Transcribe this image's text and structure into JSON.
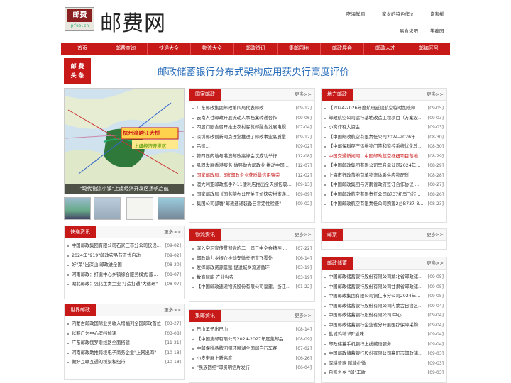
{
  "site": {
    "logo_top": "邮费",
    "logo_bottom": "pfee.cn",
    "name": "邮费网"
  },
  "toplinks": [
    "吃海鲜网",
    "家乡的特色作文",
    "询害缓",
    "易食烤吧",
    "笑癫园"
  ],
  "nav": [
    "首页",
    "邮费查询",
    "快递大全",
    "物流大全",
    "邮政资讯",
    "集邮园地",
    "邮政展会",
    "邮政人才",
    "邮编区号"
  ],
  "badge": {
    "line1": "邮 费",
    "line2": "头 条"
  },
  "headline": "邮政储蓄银行分布式架构应用获央行高度评价",
  "slideshow": {
    "caption": "\"现代物流小镇\"上虞经济开发区扬帆启航",
    "map_title": "杭州湾跨江大桥",
    "map_subtitle": "上虞经济开发区"
  },
  "panels": {
    "guonei": {
      "title": "国家邮政",
      "more": "更多>>",
      "items": [
        {
          "t": "广东邮政集团邮政第四局代表邮政",
          "d": "[09-12]"
        },
        {
          "t": "云南人社邮政开展流动人事档案转递合作",
          "d": "[09-06]"
        },
        {
          "t": "四届门限合召开推进农村客货邮融合发展电视电…",
          "d": "[07-04]"
        },
        {
          "t": "深圳邮政创新网点理念推进了邮政事业高质量发展…",
          "d": "[09-12]"
        },
        {
          "t": "吕建…",
          "d": "[09-02]"
        },
        {
          "t": "第四届内地与港澳邮政高峰会议成功举行",
          "d": "[12-08]"
        },
        {
          "t": "巩固发展香港服务 做强做大邮政业 推动中国邮…",
          "d": "[12-07]"
        },
        {
          "t": "国家邮政局：5家邮政企业获质量信用殊荣",
          "d": "[12-02]",
          "red": true
        },
        {
          "t": "澳大利亚邮政携手7-11便利店推出全天候包裹储…",
          "d": "[09-13]"
        },
        {
          "t": "国家邮政局《国务院办公厅关于加快农村寄递物流…",
          "d": "[09-09]"
        },
        {
          "t": "集团公司部署\"邮递速递装备日常定性检查\"",
          "d": "[09-02]"
        }
      ]
    },
    "difang": {
      "title": "地方邮政",
      "more": "更多>>",
      "items": [
        {
          "t": "【2024-2026年度航班延误航空临时加班邮路业务外包…",
          "d": "[09-05]"
        },
        {
          "t": "邮政航空公司运行基地改造工程项目（方案设计…",
          "d": "[09-03]"
        },
        {
          "t": "小窝作有大资金",
          "d": "[09-03]"
        },
        {
          "t": "【中国邮政航空有限责任公司2024-2026年飞机地…",
          "d": "[08-30]"
        },
        {
          "t": "【中邮保科存庄运维物门禁和监控系统优化改造…",
          "d": "[08-30]"
        },
        {
          "t": "中国交通新闻网：中国邮政航空枢纽项目落地郑州",
          "d": "[08-29]",
          "red": true
        },
        {
          "t": "【中国邮政集团有限公司黑名单公司2024年年…",
          "d": "[08-29]"
        },
        {
          "t": "上海市行政落地首单物流体系供应物配货",
          "d": "[08-28]"
        },
        {
          "t": "【中国邮政集团与河南省政府签订合作协议 中国邮…",
          "d": "[08-27]"
        },
        {
          "t": "【中国邮政航空有限责任公司B737机型飞行员租…",
          "d": "[08-26]"
        },
        {
          "t": "【中国邮政航空有限责任公司购置2台B737-800F…",
          "d": "[08-23]"
        }
      ]
    },
    "kuaidi": {
      "title": "快递资讯",
      "more": "更多>>",
      "items": [
        {
          "t": "中国邮政集团有限公司石家庄市分公司快递包…",
          "d": "[09-02]"
        },
        {
          "t": "2024年\"919\"邮政农品节正式启动",
          "d": "[09-02]"
        },
        {
          "t": "好\"菜\"出深山 邮政进全国",
          "d": "[08-20]"
        },
        {
          "t": "河南邮政：打造中心乡镇综合服务模式 服务乡…",
          "d": "[08-07]"
        },
        {
          "t": "湖北邮政：强化主责主业 打造打通\"大循环\"",
          "d": "[08-07]"
        }
      ]
    },
    "wuliu": {
      "title": "物流资讯",
      "more": "更多>>",
      "items": [
        {
          "t": "深入学习宣传贯彻党的二十届三中全会精神 推动…",
          "d": "[07-22]"
        },
        {
          "t": "邮政助力乡振介推动安徽长把直飞零外",
          "d": "[06-14]"
        },
        {
          "t": "发挥邮政资源禀赋 促进城乡流通循环",
          "d": "[03-19]"
        },
        {
          "t": "数商赋能 产业兴农",
          "d": "[03-19]"
        },
        {
          "t": "【中国邮政速递物流股份有限公司福建、浙江部…",
          "d": "[01-22]"
        }
      ]
    },
    "youpiao": {
      "title": "邮票",
      "more": "更多>>",
      "items": []
    },
    "shijie": {
      "title": "世界邮政",
      "more": "更多>>",
      "items": [
        {
          "t": "内蒙古邮政国际业务收入增幅列全国邮政首位",
          "d": "[03-27]"
        },
        {
          "t": "以客户为中心提档加速",
          "d": "[03-08]"
        },
        {
          "t": "广东邮政俄罗斯线路全面搭建",
          "d": "[11-21]"
        },
        {
          "t": "河南邮政助推跨境电子商务企业\"上网出海\"",
          "d": "[10-18]"
        },
        {
          "t": "做好互联互通的桥梁和纽带",
          "d": "[10-18]"
        }
      ]
    },
    "jiyou": {
      "title": "集邮资讯",
      "more": "更多>>",
      "items": [
        {
          "t": "巴山羊子出巴山",
          "d": "[08-14]"
        },
        {
          "t": "【中国集邮有限公司2024-2027年度集邮品定点服…",
          "d": "[08-09]"
        },
        {
          "t": "中邮保税品牌问铜环展湖全国邮自行车赛",
          "d": "[07-02]"
        },
        {
          "t": "小皮带展上新高度",
          "d": "[06-26]"
        },
        {
          "t": "\"民族团结\"邮资明信片发行",
          "d": "[06-04]"
        }
      ]
    },
    "chuxu": {
      "title": "邮政储蓄",
      "more": "更多>>",
      "items": [
        {
          "t": "中国邮政储蓄银行股份有限公司湖北省邮政储蓄…",
          "d": "[09-05]"
        },
        {
          "t": "中国邮政储蓄银行股份有限公司甘肃省邮政储蓄…",
          "d": "[09-05]"
        },
        {
          "t": "中国邮政集团有限公司铜仁市分公司2024年全…",
          "d": "[09-05]"
        },
        {
          "t": "中国邮政储蓄银行股份有限公司内蒙古自治区邮…",
          "d": "[09-04]"
        },
        {
          "t": "中国邮政储蓄银行股份有限公司 中心…",
          "d": "[09-04]"
        },
        {
          "t": "中国邮政储蓄银行企业省分开展医疗保障采购项目(第二…",
          "d": "[09-04]"
        },
        {
          "t": "盐城鸡墩\"邮\"滋味",
          "d": "[09-04]"
        },
        {
          "t": "邮政储蓄手机银行上线藏语服务",
          "d": "[09-04]"
        },
        {
          "t": "中国邮政储蓄银行股份有限公司襄阳市邮政储蓄…",
          "d": "[09-03]"
        },
        {
          "t": "深耕普惠 赋能小微",
          "d": "[09-03]"
        },
        {
          "t": "自涨之乡 \"邮\"丰收",
          "d": "[09-03]"
        }
      ]
    }
  },
  "colors": {
    "brand": "#c81919",
    "headline": "#2a6ebb"
  }
}
